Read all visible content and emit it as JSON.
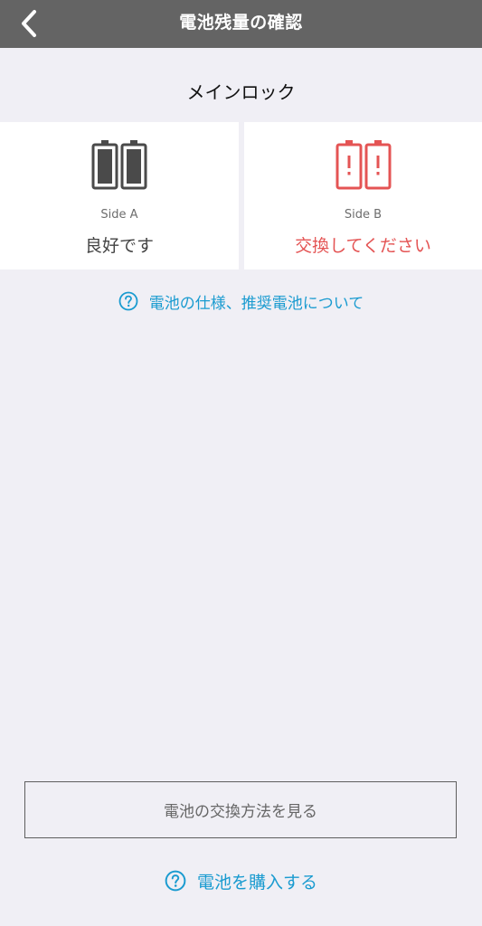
{
  "header": {
    "title": "電池残量の確認",
    "back_icon": "chevron-left-icon"
  },
  "lock": {
    "name": "メインロック"
  },
  "sides": [
    {
      "label": "Side A",
      "status": "良好です",
      "icon": "battery-ok-icon",
      "color": "#4a4a4a"
    },
    {
      "label": "Side B",
      "status": "交換してください",
      "icon": "battery-warning-icon",
      "color": "#e45454"
    }
  ],
  "links": {
    "battery_info": "電池の仕様、推奨電池について",
    "buy_battery": "電池を購入する"
  },
  "buttons": {
    "replace_method": "電池の交換方法を見る"
  },
  "colors": {
    "header_bg": "#646464",
    "page_bg": "#f0eff5",
    "link": "#1a9bd0",
    "warning": "#e45454"
  }
}
